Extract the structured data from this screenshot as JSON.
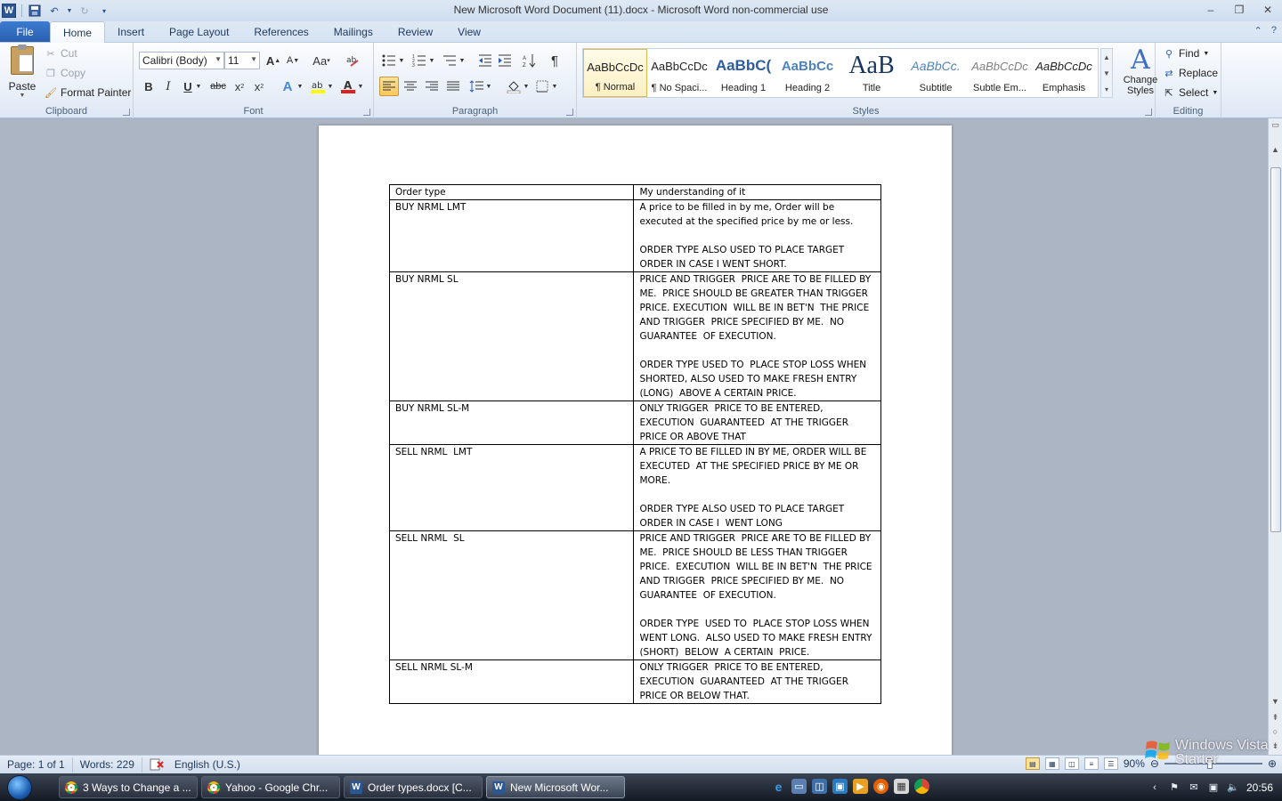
{
  "window": {
    "title": "New Microsoft Word Document (11).docx  -  Microsoft Word non-commercial use",
    "controls": [
      "minimize",
      "restore",
      "close"
    ]
  },
  "tabs": {
    "file": "File",
    "items": [
      "Home",
      "Insert",
      "Page Layout",
      "References",
      "Mailings",
      "Review",
      "View"
    ],
    "active": "Home"
  },
  "ribbon": {
    "clipboard": {
      "label": "Clipboard",
      "paste": "Paste",
      "cut": "Cut",
      "copy": "Copy",
      "format_painter": "Format Painter"
    },
    "font": {
      "label": "Font",
      "font_name": "Calibri (Body)",
      "font_size": "11"
    },
    "paragraph": {
      "label": "Paragraph"
    },
    "styles": {
      "label": "Styles",
      "items": [
        {
          "sample": "AaBbCcDc",
          "name": "¶ Normal"
        },
        {
          "sample": "AaBbCcDc",
          "name": "¶ No Spaci..."
        },
        {
          "sample": "AaBbC(",
          "name": "Heading 1"
        },
        {
          "sample": "AaBbCc",
          "name": "Heading 2"
        },
        {
          "sample": "AaB",
          "name": "Title"
        },
        {
          "sample": "AaBbCc.",
          "name": "Subtitle"
        },
        {
          "sample": "AaBbCcDc",
          "name": "Subtle Em..."
        },
        {
          "sample": "AaBbCcDc",
          "name": "Emphasis"
        }
      ],
      "change_styles_line1": "Change",
      "change_styles_line2": "Styles"
    },
    "editing": {
      "label": "Editing",
      "find": "Find",
      "replace": "Replace",
      "select": "Select"
    }
  },
  "document": {
    "header": [
      "Order type",
      "My understanding of it"
    ],
    "rows": [
      {
        "type": "BUY NRML LMT",
        "desc": [
          "A price to be filled in by me, Order will be executed at the specified price by me or less.",
          "ORDER TYPE ALSO USED TO PLACE TARGET ORDER IN CASE I WENT SHORT."
        ]
      },
      {
        "type": "BUY NRML SL",
        "desc": [
          "PRICE AND TRIGGER  PRICE ARE TO BE FILLED BY ME.  PRICE SHOULD BE GREATER THAN TRIGGER PRICE. EXECUTION  WILL BE IN BET'N  THE PRICE AND TRIGGER  PRICE SPECIFIED BY ME.  NO GUARANTEE  OF EXECUTION.",
          "ORDER TYPE USED TO  PLACE STOP LOSS WHEN SHORTED, ALSO USED TO MAKE FRESH ENTRY (LONG)  ABOVE A CERTAIN PRICE."
        ]
      },
      {
        "type": "BUY NRML SL-M",
        "desc": [
          "ONLY TRIGGER  PRICE TO BE ENTERED, EXECUTION  GUARANTEED  AT THE TRIGGER PRICE OR ABOVE THAT"
        ]
      },
      {
        "type": "SELL NRML  LMT",
        "desc": [
          "A PRICE TO BE FILLED IN BY ME, ORDER WILL BE EXECUTED  AT THE SPECIFIED PRICE BY ME OR MORE.",
          "ORDER TYPE ALSO USED TO PLACE TARGET ORDER IN CASE I  WENT LONG"
        ]
      },
      {
        "type": "SELL NRML  SL",
        "desc": [
          "PRICE AND TRIGGER  PRICE ARE TO BE FILLED BY ME.  PRICE SHOULD BE LESS THAN TRIGGER PRICE.  EXECUTION  WILL BE IN BET'N  THE PRICE AND TRIGGER  PRICE SPECIFIED BY ME.  NO GUARANTEE  OF EXECUTION.",
          "ORDER TYPE  USED TO  PLACE STOP LOSS WHEN WENT LONG.  ALSO USED TO MAKE FRESH ENTRY (SHORT)  BELOW  A CERTAIN  PRICE."
        ]
      },
      {
        "type": "SELL NRML SL-M",
        "desc": [
          "ONLY TRIGGER  PRICE TO BE ENTERED, EXECUTION  GUARANTEED  AT THE TRIGGER PRICE OR BELOW THAT."
        ]
      }
    ]
  },
  "status": {
    "page": "Page: 1 of 1",
    "words": "Words: 229",
    "language": "English (U.S.)",
    "zoom": "90%"
  },
  "watermark": {
    "line1": "Windows Vista",
    "line2": "Starter"
  },
  "taskbar": {
    "buttons": [
      {
        "label": "3 Ways to Change a ...",
        "icon": "chrome-icon"
      },
      {
        "label": "Yahoo - Google Chr...",
        "icon": "chrome-icon"
      },
      {
        "label": "Order types.docx [C...",
        "icon": "word-icon"
      },
      {
        "label": "New Microsoft Wor...",
        "icon": "word-icon",
        "active": true
      }
    ],
    "clock": "20:56"
  }
}
